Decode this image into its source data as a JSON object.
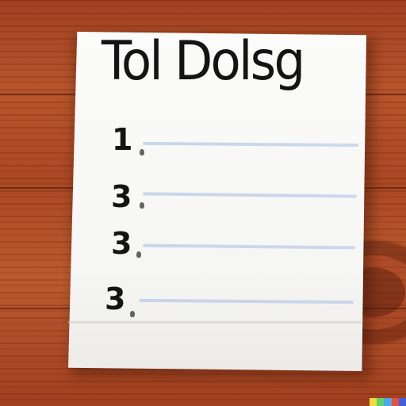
{
  "note": {
    "title": "Tol Dolsg",
    "items": [
      {
        "number": "1"
      },
      {
        "number": "3"
      },
      {
        "number": "3"
      },
      {
        "number": "3"
      }
    ]
  },
  "colors": {
    "wood": "#a64521",
    "paper": "#f8f8f6",
    "ink": "#141414",
    "rule_line": "#b4c6e8"
  },
  "badge_colors": [
    "#f5d83a",
    "#5fd36b",
    "#4aa8e8",
    "#e8503a",
    "#3f5fe0"
  ]
}
